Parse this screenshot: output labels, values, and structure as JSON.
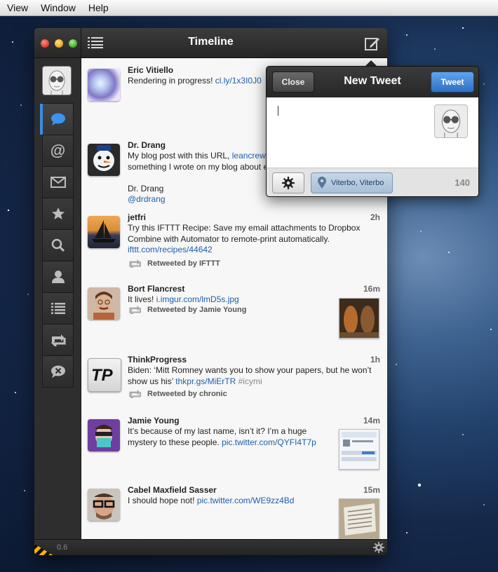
{
  "menubar": {
    "items": [
      "View",
      "Window",
      "Help"
    ]
  },
  "window": {
    "title": "Timeline",
    "version": "0.6"
  },
  "colors": {
    "accent": "#3a8ee6",
    "link": "#1e5fa8",
    "tweet_button": "#2f6fc4"
  },
  "sidebar": {
    "items": [
      {
        "name": "timeline",
        "icon": "speech-bubble-icon",
        "active": true
      },
      {
        "name": "mentions",
        "icon": "at-icon"
      },
      {
        "name": "messages",
        "icon": "envelope-icon"
      },
      {
        "name": "favorites",
        "icon": "star-icon"
      },
      {
        "name": "search",
        "icon": "search-icon"
      },
      {
        "name": "profile",
        "icon": "person-icon"
      },
      {
        "name": "lists",
        "icon": "list-icon"
      },
      {
        "name": "retweets",
        "icon": "retweet-icon"
      },
      {
        "name": "muted",
        "icon": "mute-icon"
      }
    ]
  },
  "tweets": [
    {
      "name": "Eric Vitiello",
      "time": "",
      "text": "Rendering in progress!",
      "link": "cl.ly/1x3I0J0",
      "retweeted_by": ""
    },
    {
      "name": "Dr. Drang",
      "time": "",
      "text1": "My blog post with this URL,",
      "link": "leancrew",
      "text2": "something I wrote on my blog about e",
      "sig1": "Dr. Drang",
      "sig2": "@drdrang"
    },
    {
      "name": "jetfri",
      "time": "2h",
      "text": "Try this IFTTT Recipe: Save my email attachments to Dropbox Combine with Automator to remote-print automatically.",
      "link": "ifttt.com/recipes/44642",
      "retweeted_by": "Retweeted by IFTTT"
    },
    {
      "name": "Bort Flancrest",
      "time": "16m",
      "text": "It lives!",
      "link": "i.imgur.com/lmD5s.jpg",
      "retweeted_by": "Retweeted by Jamie Young"
    },
    {
      "name": "ThinkProgress",
      "time": "1h",
      "text": "Biden: ‘Mitt Romney wants you to show your papers, but he won’t show us his’",
      "link": "thkpr.gs/MiErTR",
      "hashtag": "#icymi",
      "retweeted_by": "Retweeted by chronic"
    },
    {
      "name": "Jamie Young",
      "time": "14m",
      "text": "It’s because of my last name, isn’t it? I’m a huge mystery to these people.",
      "link": "pic.twitter.com/QYFI4T7p"
    },
    {
      "name": "Cabel Maxfield Sasser",
      "time": "15m",
      "text": "I should hope not!",
      "link": "pic.twitter.com/WE9zz4Bd"
    }
  ],
  "new_tweet": {
    "title": "New Tweet",
    "close_label": "Close",
    "tweet_label": "Tweet",
    "location": "Viterbo, Viterbo",
    "char_count": "140",
    "text": ""
  }
}
